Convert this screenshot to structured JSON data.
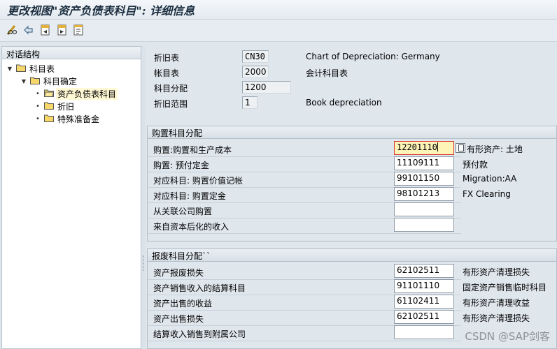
{
  "title": "更改视图\"资产负债表科目\": 详细信息",
  "toolbar": {
    "icons": [
      "edit-pencil-glasses-icon",
      "undo-icon",
      "previous-entry-icon",
      "next-entry-icon",
      "copy-icon"
    ]
  },
  "tree": {
    "header": "对话结构",
    "nodes": [
      {
        "label": "科目表",
        "level": 0,
        "toggle": "▼",
        "selected": false
      },
      {
        "label": "科目确定",
        "level": 1,
        "toggle": "▼",
        "selected": false
      },
      {
        "label": "资产负债表科目",
        "level": 2,
        "toggle": "•",
        "selected": true
      },
      {
        "label": "折旧",
        "level": 2,
        "toggle": "•",
        "selected": false
      },
      {
        "label": "特殊准备金",
        "level": 2,
        "toggle": "•",
        "selected": false
      }
    ]
  },
  "header_fields": [
    {
      "label": "折旧表",
      "value": "CN30",
      "desc": "Chart of Depreciation: Germany"
    },
    {
      "label": "帐目表",
      "value": "2000",
      "desc": "会计科目表"
    },
    {
      "label": "科目分配",
      "value": "1200",
      "desc": ""
    },
    {
      "label": "折旧范围",
      "value": "1",
      "desc": "Book depreciation"
    }
  ],
  "acquisition_group": {
    "title": "购置科目分配",
    "rows": [
      {
        "label": "购置:购置和生产成本",
        "value": "12201110",
        "desc": "有形资产: 土地",
        "focused": true
      },
      {
        "label": "购置: 预付定金",
        "value": "11109111",
        "desc": "预付款",
        "focused": false
      },
      {
        "label": "对应科目: 购置价值记帐",
        "value": "99101150",
        "desc": "Migration:AA",
        "focused": false
      },
      {
        "label": "对应科目: 购置定金",
        "value": "98101213",
        "desc": "FX Clearing",
        "focused": false
      },
      {
        "label": "从关联公司购置",
        "value": "",
        "desc": "",
        "focused": false
      },
      {
        "label": "来自资本后化的收入",
        "value": "",
        "desc": "",
        "focused": false
      }
    ]
  },
  "retirement_group": {
    "title": "报废科目分配``",
    "rows": [
      {
        "label": "资产报废损失",
        "value": "62102511",
        "desc": "有形资产清理损失"
      },
      {
        "label": "资产销售收入的结算科目",
        "value": "91101110",
        "desc": "固定资产销售临时科目"
      },
      {
        "label": "资产出售的收益",
        "value": "61102411",
        "desc": "有形资产清理收益"
      },
      {
        "label": "资产出售损失",
        "value": "62102511",
        "desc": "有形资产清理损失"
      },
      {
        "label": "结算收入销售到附属公司",
        "value": "",
        "desc": ""
      }
    ]
  },
  "watermark": "CSDN @SAP剑客"
}
